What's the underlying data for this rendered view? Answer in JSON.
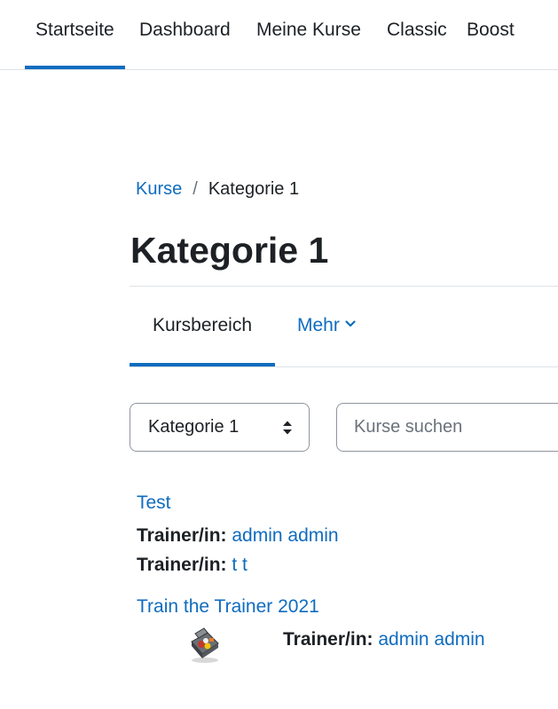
{
  "topnav": {
    "items": [
      {
        "label": "Startseite",
        "active": true
      },
      {
        "label": "Dashboard"
      },
      {
        "label": "Meine Kurse"
      },
      {
        "label": "Classic"
      },
      {
        "label": "Boost"
      }
    ]
  },
  "breadcrumb": {
    "parent": "Kurse",
    "separator": "/",
    "current": "Kategorie 1"
  },
  "page": {
    "title": "Kategorie 1"
  },
  "secondary_nav": {
    "tab_main": "Kursbereich",
    "tab_more": "Mehr"
  },
  "filters": {
    "category_selected": "Kategorie 1",
    "search_placeholder": "Kurse suchen"
  },
  "courses": [
    {
      "name": "Test",
      "teachers": [
        {
          "role": "Trainer/in:",
          "name": "admin admin"
        },
        {
          "role": "Trainer/in:",
          "name": "t t"
        }
      ]
    },
    {
      "name": "Train the Trainer 2021",
      "teachers": [
        {
          "role": "Trainer/in:",
          "name": "admin admin"
        }
      ]
    }
  ],
  "colors": {
    "link": "#0f6cbf",
    "text": "#1d2125",
    "border": "#dee2e6"
  }
}
